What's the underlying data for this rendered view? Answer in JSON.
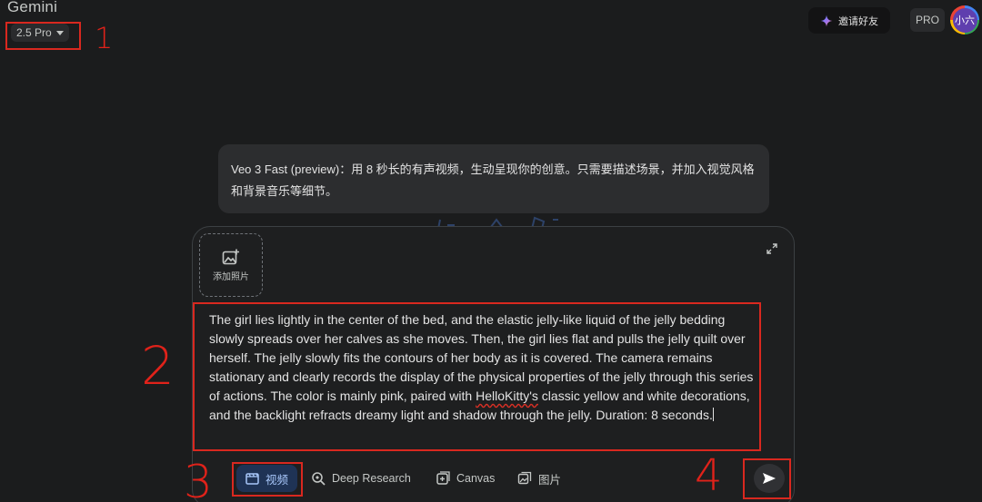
{
  "header": {
    "app_title": "Gemini",
    "model_label": "2.5 Pro",
    "invite_label": "邀请好友",
    "pro_label": "PRO",
    "avatar_text": "小六"
  },
  "info_bubble": {
    "text": "Veo 3 Fast (preview)：用 8 秒长的有声视频，生动呈现你的创意。只需要描述场景，并加入视觉风格和背景音乐等细节。"
  },
  "composer": {
    "add_photo_label": "添加照片",
    "prompt_before": "The girl lies lightly in the center of the bed, and the elastic jelly-like liquid of the jelly bedding slowly spreads over her calves as she moves. Then, the girl lies flat and pulls the jelly quilt over herself. The jelly slowly fits the contours of her body as it is covered. The camera remains stationary and clearly records the display of the physical properties of the jelly through this series of actions. The color is mainly pink, paired with ",
    "prompt_misspelled": "HelloKitty's",
    "prompt_after": " classic yellow and white decorations, and the backlight refracts dreamy light and shadow through the jelly. Duration: 8 seconds."
  },
  "toolbar": {
    "video_label": "视频",
    "deep_research_label": "Deep Research",
    "canvas_label": "Canvas",
    "image_label": "图片"
  },
  "annotations": {
    "n1": "1",
    "n2": "2",
    "n3": "3",
    "n4": "4"
  },
  "colors": {
    "background": "#1b1c1d",
    "annotation_red": "#d9281f",
    "video_chip_bg": "#1f3355",
    "video_chip_text": "#a8c7fa",
    "avatar_bg": "#5f3fae"
  }
}
